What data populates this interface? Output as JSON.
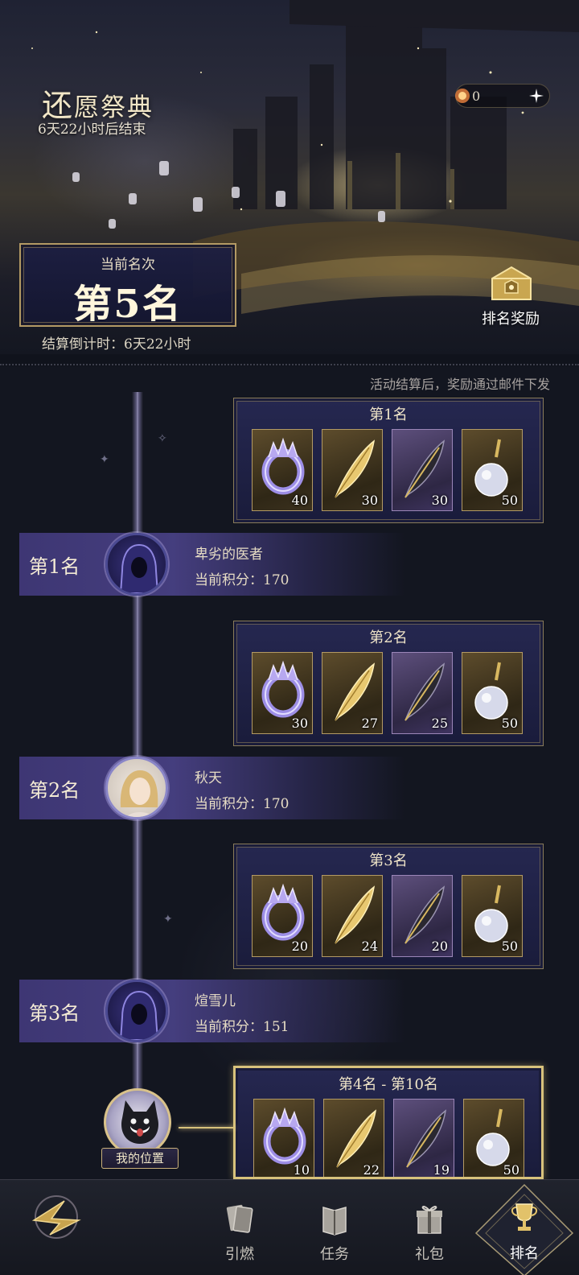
{
  "header": {
    "title_first_char": "还",
    "title_rest": "愿祭典",
    "subtitle": "6天22小时后结束",
    "currency_amount": "0"
  },
  "current_rank": {
    "label": "当前名次",
    "value": "第5名",
    "countdown": "结算倒计时：6天22小时"
  },
  "rank_reward_button": {
    "label": "排名奖励"
  },
  "mail_note": "活动结算后，奖励通过邮件下发",
  "reward_tiers": [
    {
      "title": "第1名",
      "items": [
        {
          "icon": "crystal-ring-icon",
          "qty": "40"
        },
        {
          "icon": "golden-feather-icon",
          "qty": "30"
        },
        {
          "icon": "dark-feather-icon",
          "qty": "30"
        },
        {
          "icon": "potion-bottle-icon",
          "qty": "50"
        }
      ]
    },
    {
      "title": "第2名",
      "items": [
        {
          "icon": "crystal-ring-icon",
          "qty": "30"
        },
        {
          "icon": "golden-feather-icon",
          "qty": "27"
        },
        {
          "icon": "dark-feather-icon",
          "qty": "25"
        },
        {
          "icon": "potion-bottle-icon",
          "qty": "50"
        }
      ]
    },
    {
      "title": "第3名",
      "items": [
        {
          "icon": "crystal-ring-icon",
          "qty": "20"
        },
        {
          "icon": "golden-feather-icon",
          "qty": "24"
        },
        {
          "icon": "dark-feather-icon",
          "qty": "20"
        },
        {
          "icon": "potion-bottle-icon",
          "qty": "50"
        }
      ]
    },
    {
      "title": "第4名 - 第10名",
      "items": [
        {
          "icon": "crystal-ring-icon",
          "qty": "10"
        },
        {
          "icon": "golden-feather-icon",
          "qty": "22"
        },
        {
          "icon": "dark-feather-icon",
          "qty": "19"
        },
        {
          "icon": "potion-bottle-icon",
          "qty": "50"
        }
      ]
    }
  ],
  "leaderboard": [
    {
      "rank": "第1名",
      "name": "卑劣的医者",
      "score": "当前积分：170",
      "avatar": "hooded-figure-avatar"
    },
    {
      "rank": "第2名",
      "name": "秋天",
      "score": "当前积分：170",
      "avatar": "blonde-portrait-avatar"
    },
    {
      "rank": "第3名",
      "name": "煊雪儿",
      "score": "当前积分：151",
      "avatar": "hooded-figure-avatar"
    }
  ],
  "my_position": {
    "label": "我的位置",
    "avatar": "black-cat-avatar"
  },
  "bottom_nav": [
    {
      "label": "引燃",
      "icon": "cards-icon"
    },
    {
      "label": "任务",
      "icon": "book-icon"
    },
    {
      "label": "礼包",
      "icon": "gift-icon"
    },
    {
      "label": "排名",
      "icon": "trophy-icon",
      "active": true
    }
  ],
  "colors": {
    "gold_border": "#d8c27c",
    "panel_purple": "#262852",
    "text_cream": "#e6dcc4"
  }
}
